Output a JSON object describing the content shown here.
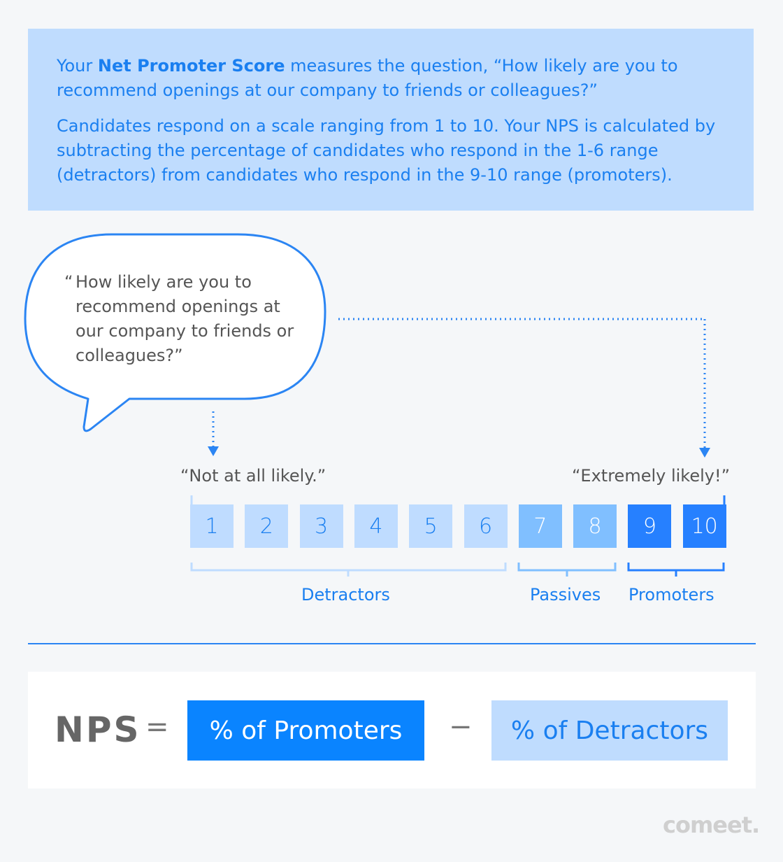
{
  "intro": {
    "p1_pre": "Your ",
    "p1_bold": "Net Promoter Score",
    "p1_post": " measures the question, “How likely are you to recommend openings at our company to friends or colleagues?”",
    "p2": "Candidates respond on a scale ranging from 1 to 10. Your NPS is calculated by subtracting the percentage of candidates who respond in the 1-6 range (detractors) from candidates who respond in the 9-10 range (promoters)."
  },
  "bubble": {
    "open_quote": "“",
    "text": "How likely are you to recommend openings at our company to friends or colleagues?”"
  },
  "scale": {
    "low_label": "“Not at all likely.”",
    "high_label": "“Extremely likely!”",
    "numbers": [
      "1",
      "2",
      "3",
      "4",
      "5",
      "6",
      "7",
      "8",
      "9",
      "10"
    ],
    "categories": {
      "detractors": "Detractors",
      "passives": "Passives",
      "promoters": "Promoters"
    }
  },
  "formula": {
    "nps": "NPS",
    "equals": "=",
    "promoters": "% of Promoters",
    "minus": "−",
    "detractors": "% of Detractors"
  },
  "logo": "comeet.",
  "colors": {
    "light": "#bfdcff",
    "mid": "#80bfff",
    "dark": "#2680ff",
    "accent": "#0a84ff",
    "text_blue": "#1a7ff0"
  }
}
